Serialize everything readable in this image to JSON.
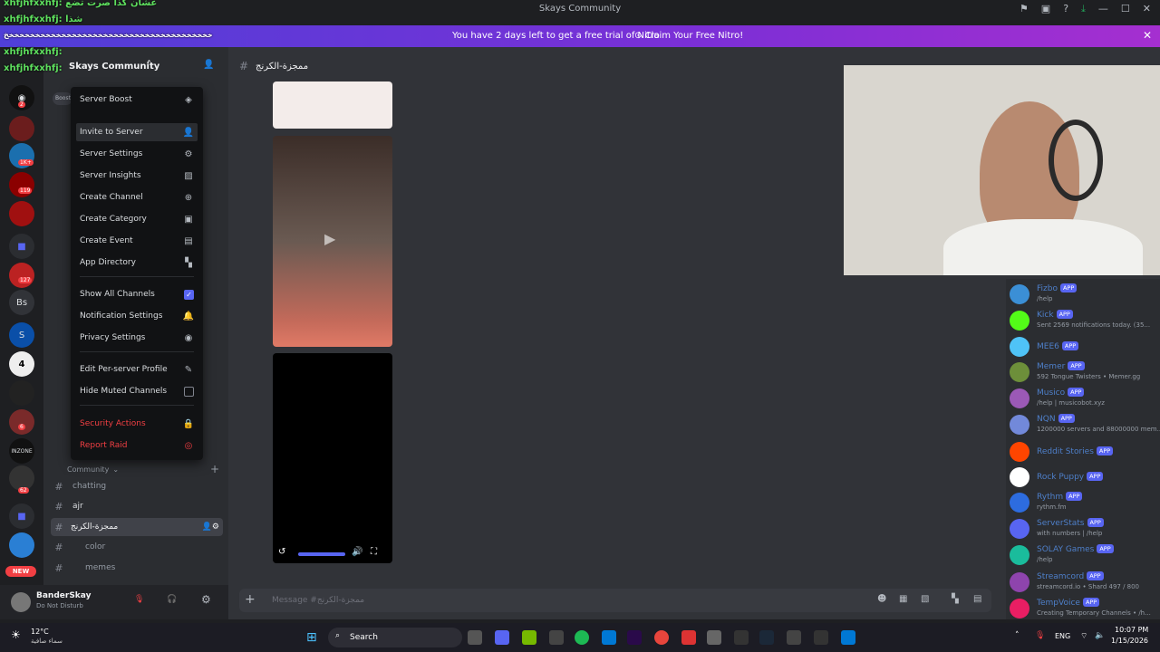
{
  "window": {
    "title": "Skays Community"
  },
  "nitro": {
    "message": "You have 2 days left to get a free trial of Nitro",
    "claim": "Claim Your Free Nitro!"
  },
  "overlay_chat": [
    "xhfjhfxxhfj: عشان كذا صرت تضع",
    "xhfjhfxxhfj: شذا",
    "خخخخخخخخخخخخخخخخخخخخخخخخخخخخخخخخخخخخخخخخ",
    "xhfjhfxxhfj: ",
    "xhfjhfxxhfj:"
  ],
  "server": {
    "name": "Skays Community"
  },
  "guild_badges": [
    "2",
    "1K+",
    "119",
    "127",
    "6",
    "62"
  ],
  "guild_labels": {
    "bs": "Bs",
    "new": "NEW"
  },
  "menu": {
    "items": [
      {
        "label": "Server Boost",
        "icon": "boost-icon"
      },
      {
        "label": "Invite to Server",
        "icon": "add-user-icon"
      },
      {
        "label": "Server Settings",
        "icon": "gear-icon"
      },
      {
        "label": "Server Insights",
        "icon": "insights-icon"
      },
      {
        "label": "Create Channel",
        "icon": "plus-circle-icon"
      },
      {
        "label": "Create Category",
        "icon": "folder-plus-icon"
      },
      {
        "label": "Create Event",
        "icon": "calendar-plus-icon"
      },
      {
        "label": "App Directory",
        "icon": "apps-icon"
      },
      {
        "label": "Show All Channels",
        "icon": "checkbox-checked-icon"
      },
      {
        "label": "Notification Settings",
        "icon": "bell-icon"
      },
      {
        "label": "Privacy Settings",
        "icon": "shield-icon"
      },
      {
        "label": "Edit Per-server Profile",
        "icon": "pencil-icon"
      },
      {
        "label": "Hide Muted Channels",
        "icon": "checkbox-empty-icon"
      },
      {
        "label": "Security Actions",
        "icon": "lock-icon"
      },
      {
        "label": "Report Raid",
        "icon": "alert-circle-icon"
      }
    ]
  },
  "sidebar": {
    "boost_label": "Boost",
    "category": "Community",
    "channels": [
      "chatting",
      "ajr",
      "ممجزة-الكرنج",
      "color",
      "memes"
    ]
  },
  "channel": {
    "name": "ممجزة-الكرنج",
    "composer_placeholder": "Message #ممجزة-الكرنج"
  },
  "user": {
    "name": "BanderSkay",
    "status": "Do Not Disturb"
  },
  "members": [
    {
      "name": "Fizbo",
      "status": "/help",
      "color": "#3b8fd6"
    },
    {
      "name": "Kick",
      "status": "Sent 2569 notifications today. (35...",
      "color": "#53fc18"
    },
    {
      "name": "MEE6",
      "status": "",
      "color": "#4fc3f7"
    },
    {
      "name": "Memer",
      "status": "592 Tongue Twisters • Memer.gg",
      "color": "#6d8f3a"
    },
    {
      "name": "Musico",
      "status": "/help | musicobot.xyz",
      "color": "#9b59b6"
    },
    {
      "name": "NQN",
      "status": "1200000 servers and 88000000 mem...",
      "color": "#7289da"
    },
    {
      "name": "Reddit Stories",
      "status": "",
      "color": "#ff4500"
    },
    {
      "name": "Rock Puppy",
      "status": "",
      "color": "#ffffff"
    },
    {
      "name": "Rythm",
      "status": "rythm.fm",
      "color": "#2d6cdf"
    },
    {
      "name": "ServerStats",
      "status": "with numbers | /help",
      "color": "#5865f2"
    },
    {
      "name": "SOLAY Games",
      "status": "/help",
      "color": "#1abc9c"
    },
    {
      "name": "Streamcord",
      "status": "streamcord.io • Shard 497 / 800",
      "color": "#8e44ad"
    },
    {
      "name": "TempVoice",
      "status": "Creating Temporary Channels • /h...",
      "color": "#e91e63"
    }
  ],
  "app_badge": "APP",
  "taskbar": {
    "weather_temp": "12°C",
    "weather_desc": "سماء صافية",
    "search": "Search",
    "lang": "ENG",
    "time": "10:07 PM",
    "date": "1/15/2026"
  }
}
